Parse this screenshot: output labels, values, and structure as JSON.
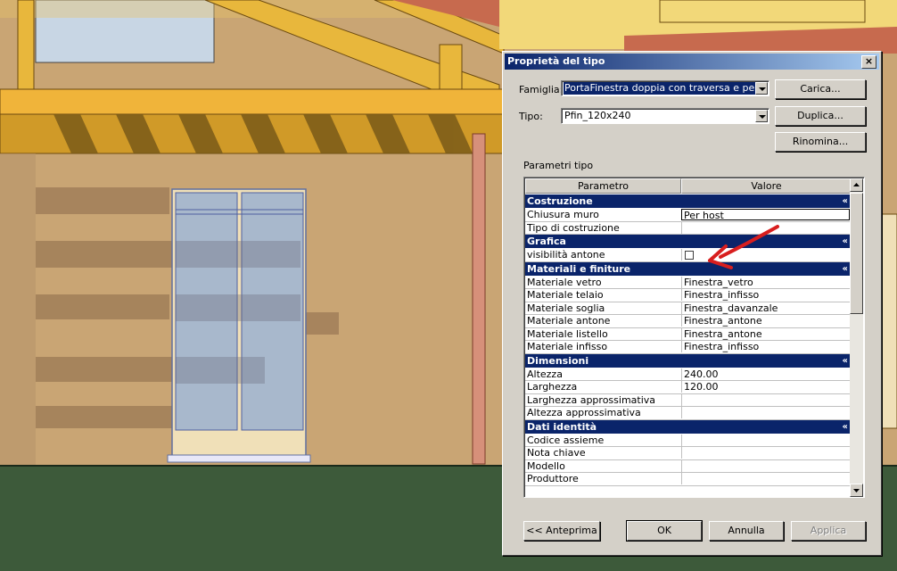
{
  "dialog": {
    "title": "Proprietà del tipo",
    "close_glyph": "×",
    "famiglia_label": "Famiglia:",
    "famiglia_value": "PortaFinestra doppia con traversa e persiana",
    "tipo_label": "Tipo:",
    "tipo_value": "Pfin_120x240",
    "carica_label": "Carica...",
    "duplica_label": "Duplica...",
    "rinomina_label": "Rinomina...",
    "parametri_label": "Parametri tipo",
    "col_parametro": "Parametro",
    "col_valore": "Valore",
    "sections": [
      {
        "title": "Costruzione",
        "rows": [
          {
            "param": "Chiusura muro",
            "value": "Per host",
            "editing": true
          },
          {
            "param": "Tipo di costruzione",
            "value": ""
          }
        ]
      },
      {
        "title": "Grafica",
        "rows": [
          {
            "param": "visibilità antone",
            "value": "",
            "checkbox": true
          }
        ]
      },
      {
        "title": "Materiali e finiture",
        "rows": [
          {
            "param": "Materiale vetro",
            "value": "Finestra_vetro"
          },
          {
            "param": "Materiale telaio",
            "value": "Finestra_infisso"
          },
          {
            "param": "Materiale soglia",
            "value": "Finestra_davanzale"
          },
          {
            "param": "Materiale antone",
            "value": "Finestra_antone"
          },
          {
            "param": "Materiale listello",
            "value": "Finestra_antone"
          },
          {
            "param": "Materiale infisso",
            "value": "Finestra_infisso"
          }
        ]
      },
      {
        "title": "Dimensioni",
        "rows": [
          {
            "param": "Altezza",
            "value": "240.00"
          },
          {
            "param": "Larghezza",
            "value": "120.00"
          },
          {
            "param": "Larghezza approssimativa",
            "value": ""
          },
          {
            "param": "Altezza approssimativa",
            "value": ""
          }
        ]
      },
      {
        "title": "Dati identità",
        "rows": [
          {
            "param": "Codice assieme",
            "value": ""
          },
          {
            "param": "Nota chiave",
            "value": ""
          },
          {
            "param": "Modello",
            "value": ""
          },
          {
            "param": "Produttore",
            "value": ""
          }
        ]
      }
    ],
    "section_chevron": "«",
    "anteprima_label": "<< Anteprima",
    "ok_label": "OK",
    "annulla_label": "Annulla",
    "applica_label": "Applica"
  },
  "colors": {
    "titlebar": "#0a246a",
    "section_header": "#0a246a",
    "annotation_arrow": "#d81e1e",
    "wall": "#c9a574",
    "ground": "#3d5a3a",
    "door_glass": "#a8b8cc"
  },
  "icons": {
    "close": "close-icon",
    "combo_arrow": "chevron-down-icon",
    "section_toggle": "collapse-chevron-icon",
    "annotation": "red-arrow-icon"
  }
}
